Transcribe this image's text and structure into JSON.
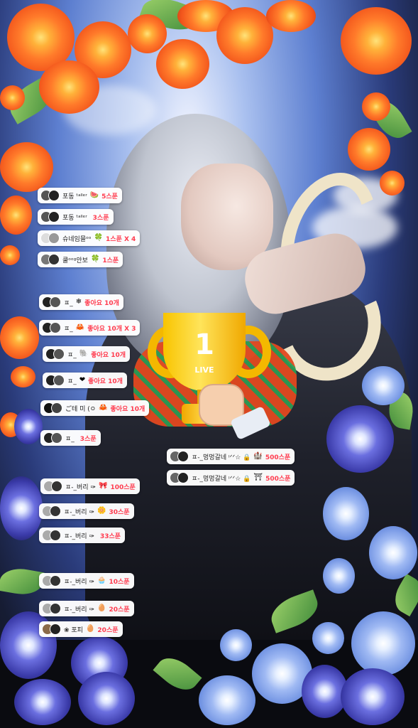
{
  "colors": {
    "gift_value": "#ff3b4e",
    "pill_bg": "#ffffff",
    "text": "#222222"
  },
  "trophy": {
    "rank": "1",
    "label": "LIVE"
  },
  "chat": [
    {
      "user": "포동 ᵗᵃˡˡᵉʳ",
      "icon": "🍉",
      "value": "5스푼"
    },
    {
      "user": "포동 ᵗᵃˡˡᵉʳ",
      "icon": "",
      "value": "3스푼"
    },
    {
      "user": "슈네임믈ᵒᵒ",
      "icon": "🍀",
      "value": "1스푼 X 4"
    },
    {
      "user": "쿨ᵒᵒᵍ안보",
      "icon": "🍀",
      "value": "1스푼"
    },
    {
      "user": "ㅍ_",
      "icon": "❄",
      "value": "좋아요 10개"
    },
    {
      "user": "ㅍ_",
      "icon": "🦀",
      "value": "좋아요 10개 X 3"
    },
    {
      "user": "ㅍ_",
      "icon": "🐘",
      "value": "좋아요 10개"
    },
    {
      "user": "ㅍ_",
      "icon": "❤",
      "value": "좋아요 10개"
    },
    {
      "user": "ご테 미 (ㅇ",
      "icon": "🦀",
      "value": "좋아요 10개"
    },
    {
      "user": "ㅍ_",
      "icon": "",
      "value": "3스푼"
    },
    {
      "user": "ㅍ-_멍멍갈네 ᵎᐟᐟ☆ 🔒",
      "icon": "🏰",
      "value": "500스푼"
    },
    {
      "user": "ㅍ-_멍멍갈네 ᵎᐟᐟ☆ 🔒",
      "icon": "⛩",
      "value": "500스푼"
    },
    {
      "user": "ㅍ-_버리 ✑",
      "icon": "🎀",
      "value": "100스푼"
    },
    {
      "user": "ㅍ-_버리 ✑",
      "icon": "🌼",
      "value": "30스푼"
    },
    {
      "user": "ㅍ-_버리 ✑",
      "icon": "",
      "value": "33스푼"
    },
    {
      "user": "ㅍ-_버리 ✑",
      "icon": "🧁",
      "value": "10스푼"
    },
    {
      "user": "ㅍ-_버리 ✑",
      "icon": "🥚",
      "value": "20스푼"
    },
    {
      "user": "❀ 포피",
      "icon": "🥚",
      "value": "20스푼"
    }
  ]
}
